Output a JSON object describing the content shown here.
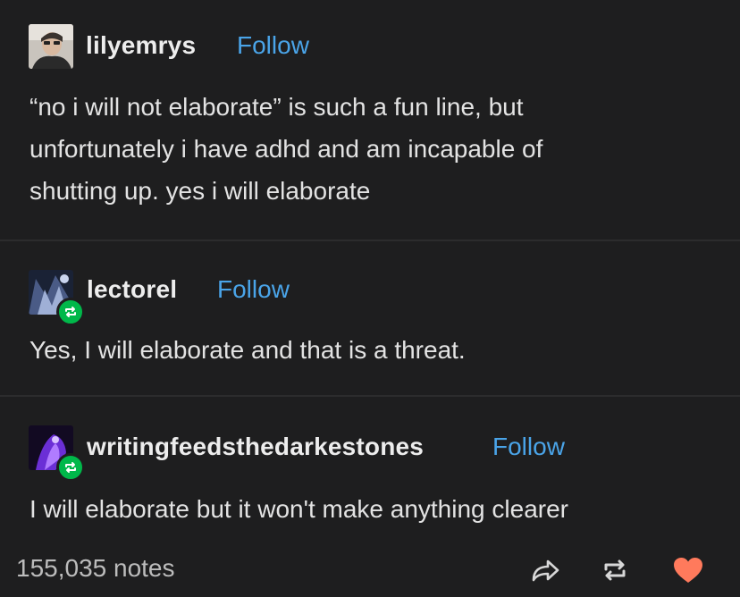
{
  "posts": [
    {
      "username": "lilyemrys",
      "follow_label": "Follow",
      "body_lines": [
        "“no i will not elaborate” is such a fun line, but",
        "unfortunately i have adhd and am incapable of",
        "shutting up. yes i will elaborate"
      ],
      "avatar_icon": "profile-photo"
    },
    {
      "username": "lectorel",
      "follow_label": "Follow",
      "body_lines": [
        "Yes, I will elaborate and that is a threat."
      ],
      "avatar_icon": "profile-illustration",
      "badge_icon": "reblog-icon"
    },
    {
      "username": "writingfeedsthedarkestones",
      "follow_label": "Follow",
      "body_lines": [
        "I will elaborate but it won't make anything clearer"
      ],
      "avatar_icon": "profile-illustration-purple",
      "badge_icon": "reblog-icon"
    }
  ],
  "footer": {
    "notes": "155,035 notes",
    "actions": [
      "share-icon",
      "reblog-icon",
      "heart-icon"
    ]
  },
  "colors": {
    "background": "#1e1e1f",
    "text": "#e3e3e3",
    "follow": "#4aa4e8",
    "reblog_badge": "#00b84a",
    "heart": "#ff7a5c",
    "divider": "#2c2c2d"
  }
}
